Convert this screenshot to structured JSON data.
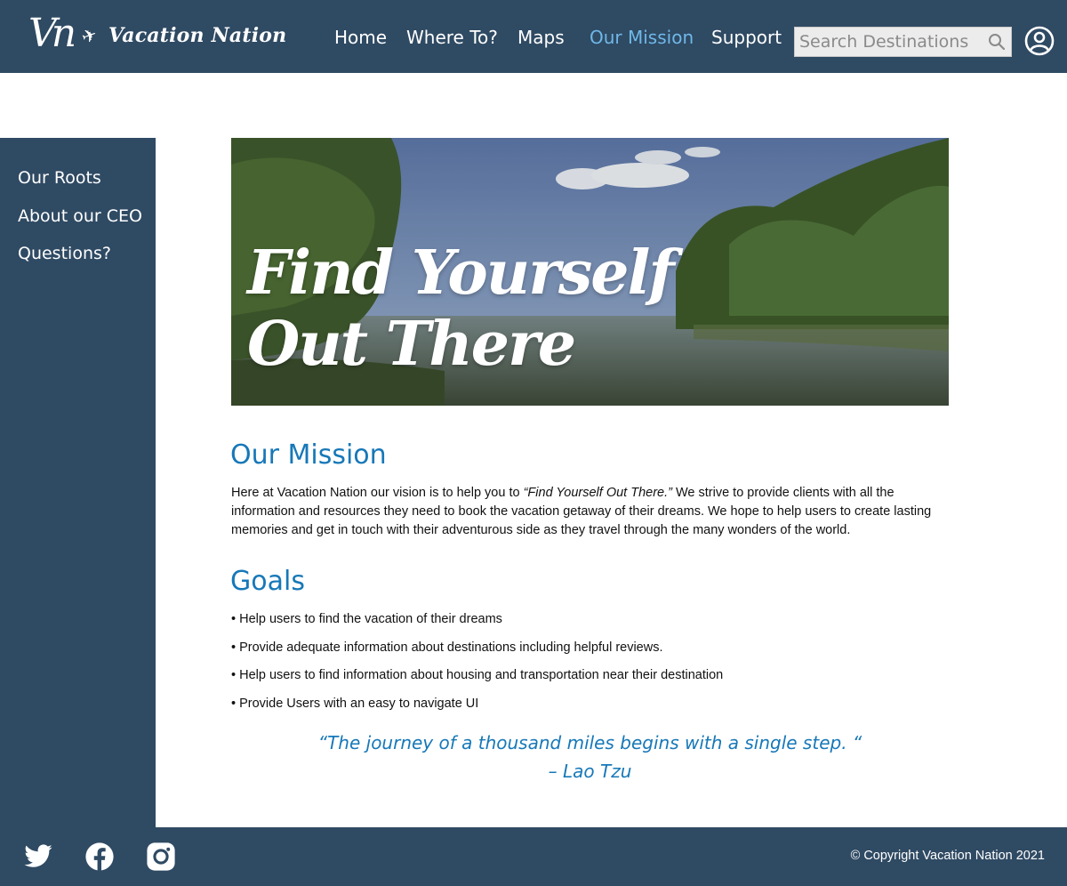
{
  "header": {
    "logo_mark": "Vn",
    "logo_text": "Vacation Nation",
    "nav": [
      {
        "label": "Home"
      },
      {
        "label": "Where To?"
      },
      {
        "label": "Maps"
      },
      {
        "label": "Our Mission",
        "active": true
      },
      {
        "label": "Support"
      }
    ],
    "search_placeholder": "Search Destinations",
    "icons": {
      "search": "search-icon",
      "account": "account-icon",
      "plane": "plane-icon"
    }
  },
  "sidebar": {
    "items": [
      {
        "label": "Our Roots"
      },
      {
        "label": "About our CEO"
      },
      {
        "label": "Questions?"
      }
    ]
  },
  "hero": {
    "line1": "Find Yourself",
    "line2": "Out There"
  },
  "mission": {
    "title": "Our Mission",
    "text_before": "Here at Vacation Nation our vision is to help you to ",
    "text_em": "“Find Yourself Out There.”",
    "text_after": " We strive to provide clients with all the information and resources they need to book the vacation getaway of their dreams. We hope to help users to create lasting memories and get in touch with their adventurous side as they travel through the many wonders of the world."
  },
  "goals": {
    "title": "Goals",
    "items": [
      "Help users to find the vacation of their dreams",
      "Provide adequate information about destinations including helpful reviews.",
      "Help users to find information about housing and transportation near their destination",
      "Provide Users with an easy to navigate UI"
    ]
  },
  "quote": {
    "text": "“The journey of a thousand miles begins with a single step. “",
    "author": "– Lao Tzu"
  },
  "footer": {
    "social": [
      "twitter-icon",
      "facebook-icon",
      "instagram-icon"
    ],
    "copyright": "© Copyright Vacation Nation 2021"
  },
  "colors": {
    "header_bg": "#2f4a63",
    "accent": "#1778b8",
    "nav_active": "#6fb8e8"
  }
}
